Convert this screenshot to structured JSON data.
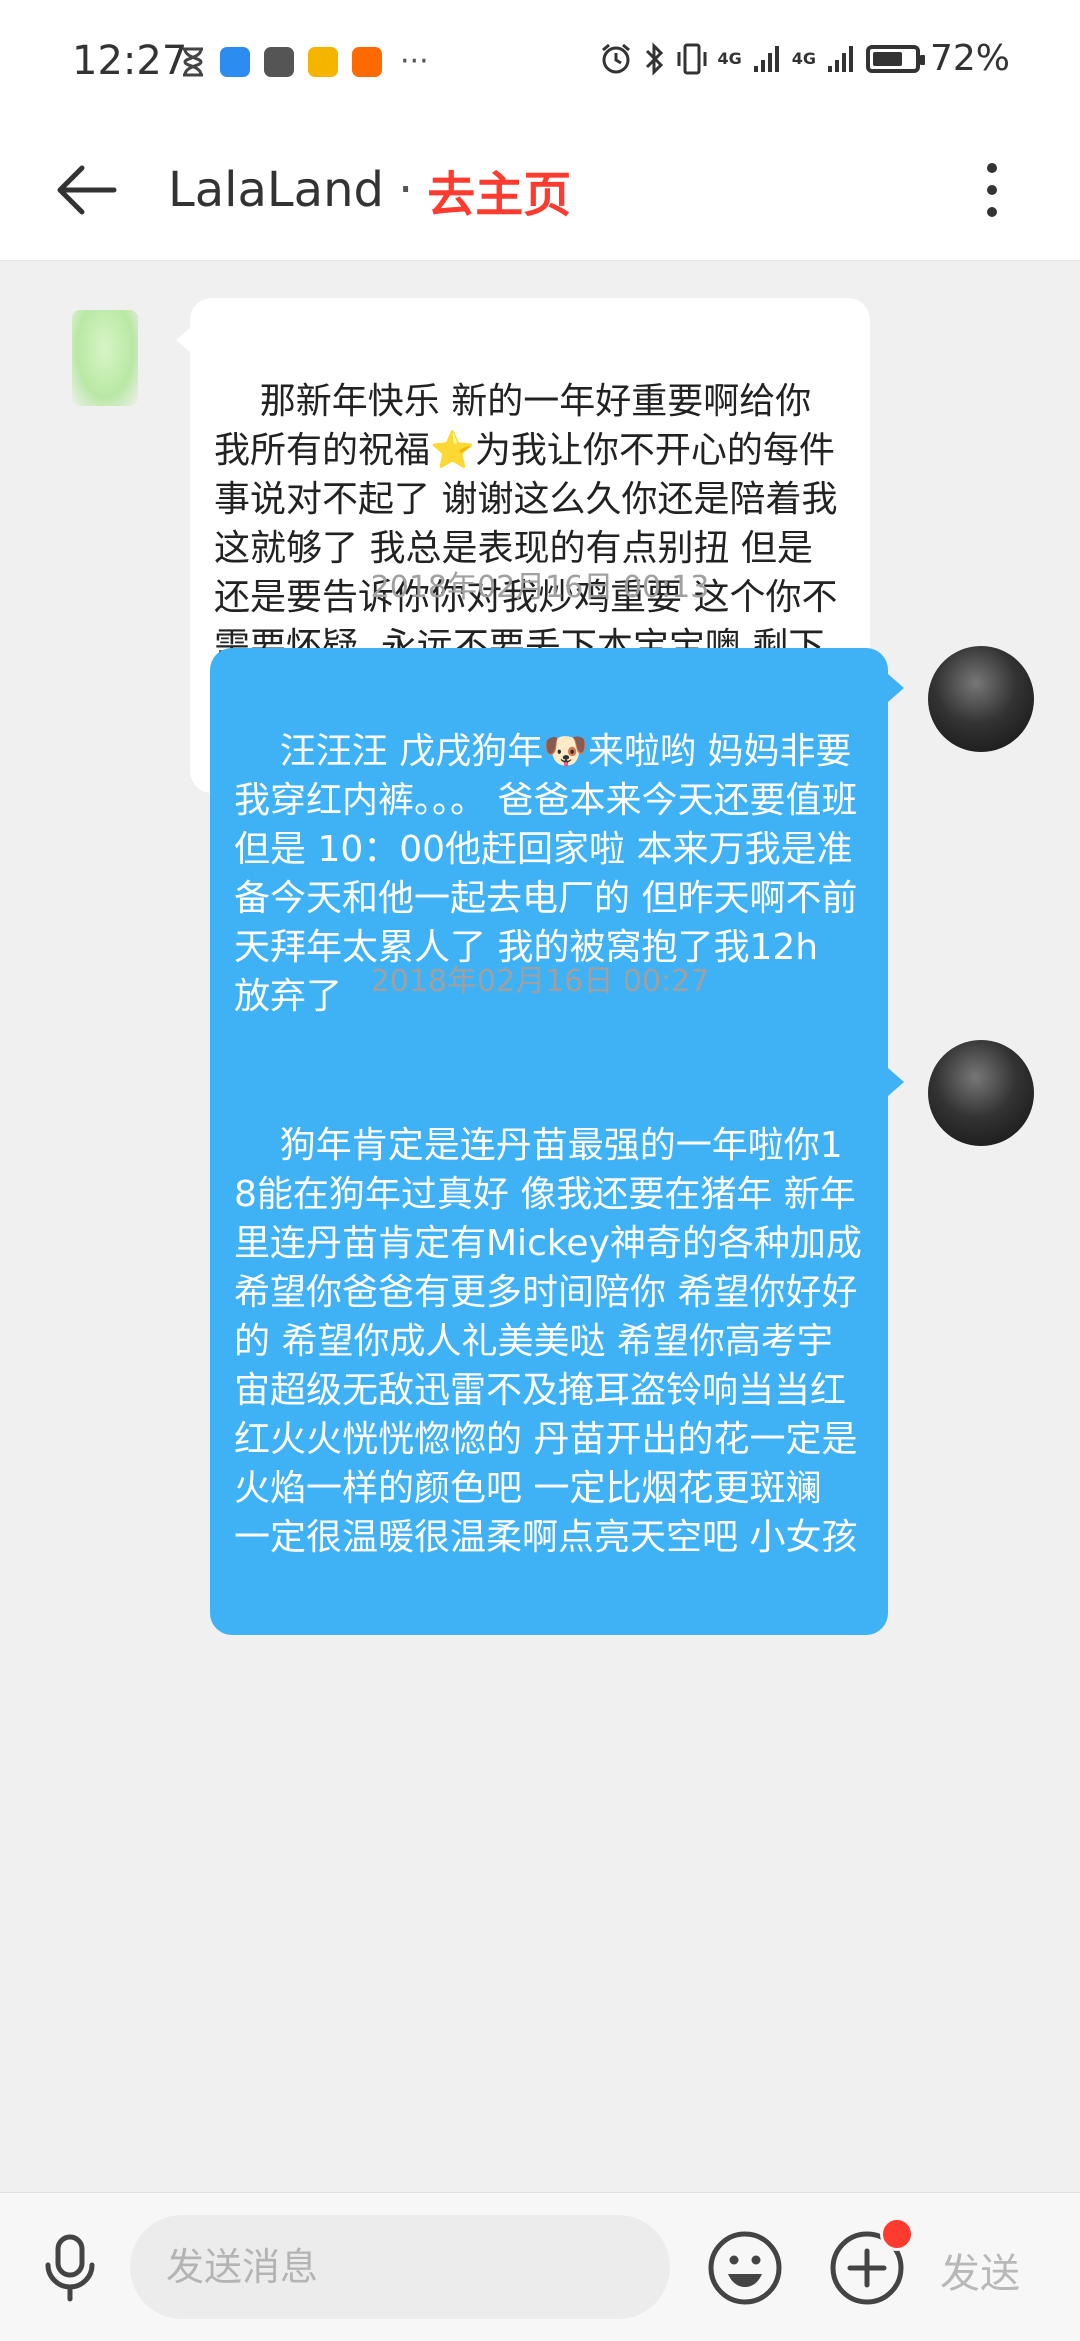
{
  "status_bar": {
    "time": "12:27",
    "signal_1": "4G",
    "signal_2": "4G",
    "battery_text": "72%",
    "battery_level": 0.72,
    "left_icons": [
      "hourglass-icon",
      "blue-app-icon",
      "bilibili-icon",
      "mail-icon",
      "taobao-icon"
    ],
    "more": "···"
  },
  "header": {
    "title": "LalaLand",
    "separator": "·",
    "homepage_link": "去主页"
  },
  "messages": [
    {
      "direction": "in",
      "text": "那新年快乐 新的一年好重要啊给你我所有的祝福⭐为我让你不开心的每件事说对不起了 谢谢这么久你还是陪着我 这就够了 我总是表现的有点别扭 但是还是要告诉你你对我炒鸡重要 这个你不需要怀疑  永远不要丢下本宝宝噢 剩下的日子里加油😃最好的童逸轩"
    },
    {
      "direction": "out",
      "timestamp": "2018年02月16日 00:13",
      "text": "汪汪汪 戊戌狗年🐶来啦哟 妈妈非要我穿红内裤。。。 爸爸本来今天还要值班 但是 10：00他赶回家啦 本来万我是准备今天和他一起去电厂的 但昨天啊不前天拜年太累人了 我的被窝抱了我12h 放弃了"
    },
    {
      "direction": "out",
      "timestamp": "2018年02月16日 00:27",
      "text": "狗年肯定是连丹苗最强的一年啦你18能在狗年过真好 像我还要在猪年 新年里连丹苗肯定有Mickey神奇的各种加成 希望你爸爸有更多时间陪你 希望你好好的 希望你成人礼美美哒 希望你高考宇宙超级无敌迅雷不及掩耳盗铃响当当红红火火恍恍惚惚的 丹苗开出的花一定是火焰一样的颜色吧 一定比烟花更斑斓 一定很温暖很温柔啊点亮天空吧 小女孩"
    }
  ],
  "input_bar": {
    "placeholder": "发送消息",
    "value": "",
    "send_label": "发送"
  },
  "colors": {
    "outgoing_bubble": "#3fb2f5",
    "incoming_bubble": "#ffffff",
    "link_red": "#ff3b30",
    "background": "#f0f0f0"
  }
}
